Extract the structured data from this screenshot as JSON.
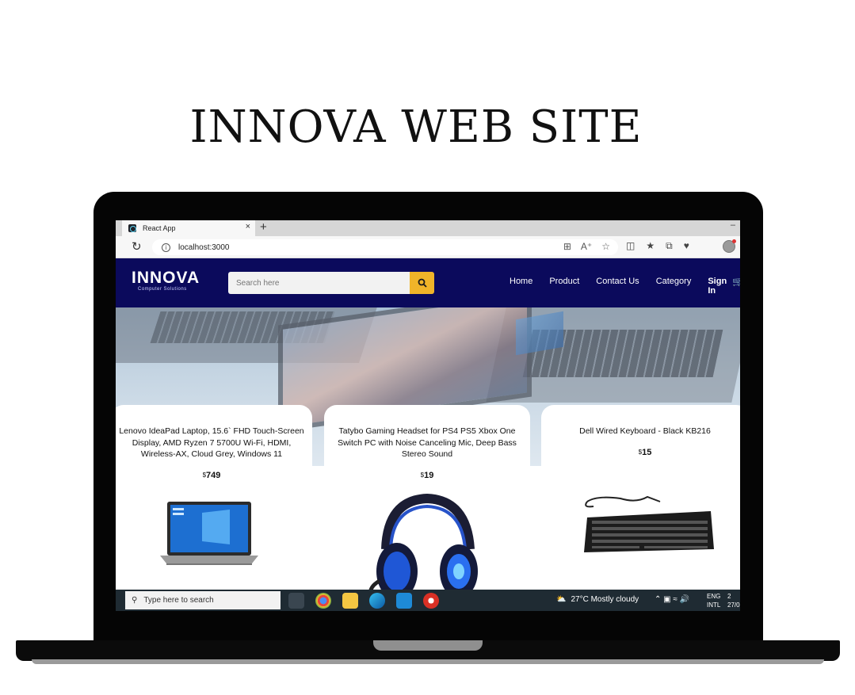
{
  "page": {
    "title": "INNOVA WEB SITE"
  },
  "browser": {
    "tab_title": "React App",
    "tab_close": "×",
    "new_tab": "+",
    "minimize": "–",
    "url": "localhost:3000",
    "reload": "C",
    "info": "i"
  },
  "site": {
    "logo": {
      "name": "INNOVA",
      "tagline": "Computer Solutions"
    },
    "search": {
      "placeholder": "Search here"
    },
    "nav": [
      "Home",
      "Product",
      "Contact Us",
      "Category"
    ],
    "signin": "Sign In",
    "colors": {
      "navbar": "#0b0a5c",
      "search_button": "#f0b429"
    }
  },
  "products": [
    {
      "title": "Lenovo IdeaPad Laptop, 15.6` FHD Touch-Screen Display, AMD Ryzen 7 5700U Wi-Fi, HDMI, Wireless-AX, Cloud Grey, Windows 11",
      "currency": "$",
      "price": "749"
    },
    {
      "title": "Tatybo Gaming Headset for PS4 PS5 Xbox One Switch PC with Noise Canceling Mic, Deep Bass Stereo Sound",
      "currency": "$",
      "price": "19"
    },
    {
      "title": "Dell Wired Keyboard - Black KB216",
      "currency": "$",
      "price": "15"
    }
  ],
  "taskbar": {
    "search_placeholder": "Type here to search",
    "weather": "27°C  Mostly cloudy",
    "lang_top": "ENG",
    "lang_bottom": "INTL",
    "clock_top": "2",
    "clock_bottom": "27/0"
  }
}
